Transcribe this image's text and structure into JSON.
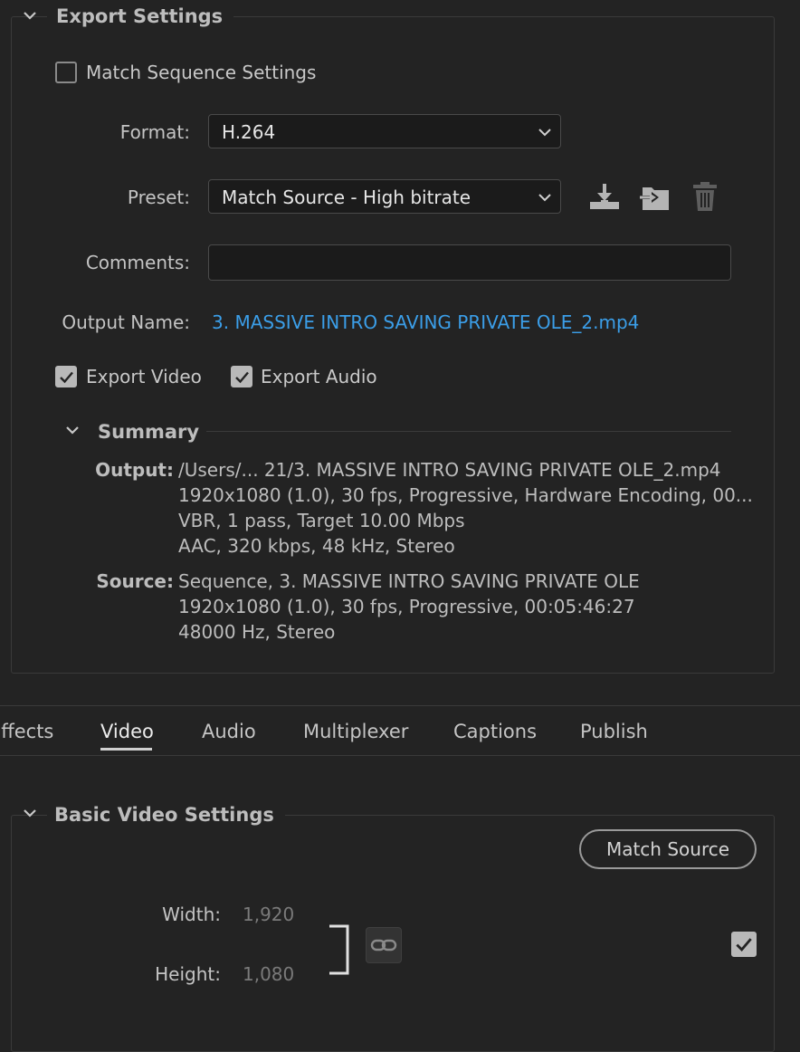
{
  "export_settings": {
    "title": "Export Settings",
    "match_sequence_label": "Match Sequence Settings",
    "match_sequence_checked": false,
    "format_label": "Format:",
    "format_value": "H.264",
    "preset_label": "Preset:",
    "preset_value": "Match Source - High bitrate",
    "comments_label": "Comments:",
    "comments_value": "",
    "output_name_label": "Output Name:",
    "output_name_value": "3. MASSIVE INTRO SAVING PRIVATE OLE_2.mp4",
    "export_video_label": "Export Video",
    "export_video_checked": true,
    "export_audio_label": "Export Audio",
    "export_audio_checked": true,
    "icons": [
      "save-preset-icon",
      "import-preset-icon",
      "delete-preset-icon"
    ]
  },
  "summary": {
    "title": "Summary",
    "output_label": "Output:",
    "output_lines": [
      "/Users/... 21/3. MASSIVE INTRO SAVING PRIVATE OLE_2.mp4",
      "1920x1080 (1.0), 30 fps, Progressive, Hardware Encoding, 00...",
      "VBR, 1 pass, Target 10.00 Mbps",
      "AAC, 320 kbps, 48 kHz, Stereo"
    ],
    "source_label": "Source:",
    "source_lines": [
      "Sequence, 3. MASSIVE INTRO SAVING PRIVATE OLE",
      "1920x1080 (1.0), 30 fps, Progressive, 00:05:46:27",
      "48000 Hz, Stereo"
    ]
  },
  "tabs": [
    {
      "label": "Effects",
      "active": false
    },
    {
      "label": "Video",
      "active": true
    },
    {
      "label": "Audio",
      "active": false
    },
    {
      "label": "Multiplexer",
      "active": false
    },
    {
      "label": "Captions",
      "active": false
    },
    {
      "label": "Publish",
      "active": false
    }
  ],
  "basic_video": {
    "title": "Basic Video Settings",
    "match_source_label": "Match Source",
    "width_label": "Width:",
    "width_value": "1,920",
    "height_label": "Height:",
    "height_value": "1,080",
    "right_checkbox_checked": true
  },
  "colors": {
    "background": "#232323",
    "link": "#3b9ee8",
    "field_bg": "#1b1b1b"
  }
}
